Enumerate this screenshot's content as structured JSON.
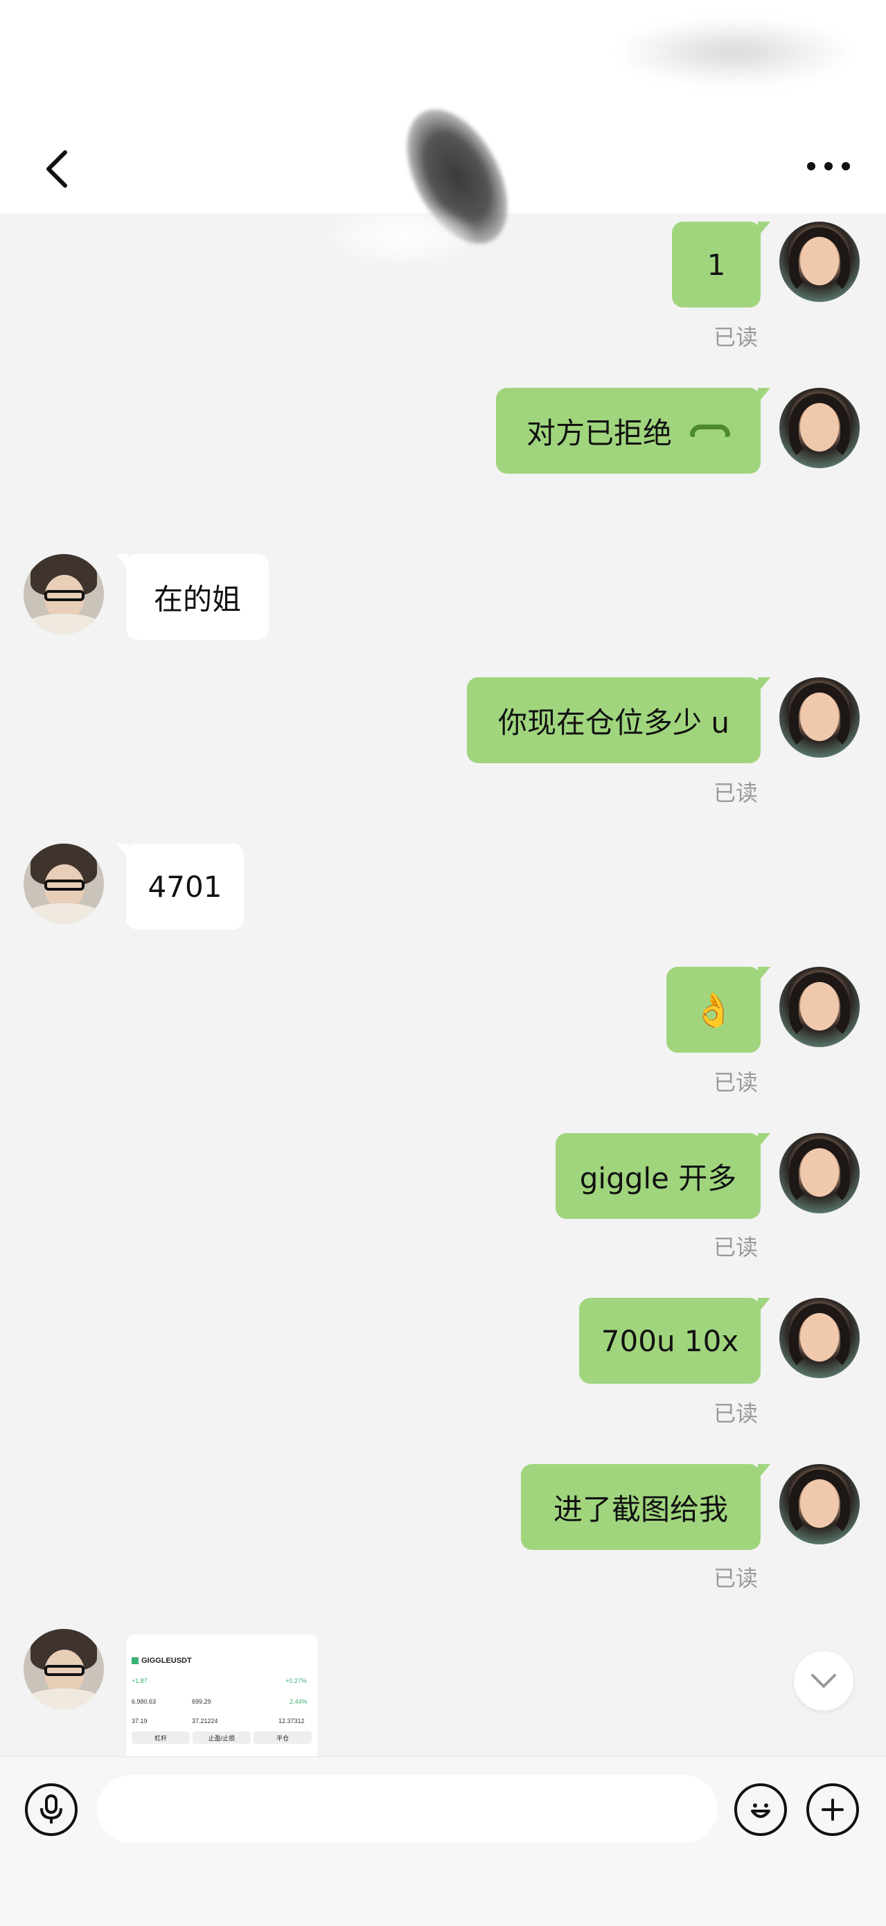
{
  "header": {
    "back_icon": "chevron-left-icon",
    "more_icon": "more-horizontal-icon"
  },
  "messages": [
    {
      "side": "out",
      "text": "1",
      "read": "已读"
    },
    {
      "side": "out",
      "text": "对方已拒绝",
      "icon": "phone-hangup-icon"
    },
    {
      "side": "in",
      "text": "在的姐"
    },
    {
      "side": "out",
      "text": "你现在仓位多少 u",
      "read": "已读"
    },
    {
      "side": "in",
      "text": "4701"
    },
    {
      "side": "out",
      "text": "👌",
      "read": "已读"
    },
    {
      "side": "out",
      "text": "giggle 开多",
      "read": "已读"
    },
    {
      "side": "out",
      "text": "700u 10x",
      "read": "已读"
    },
    {
      "side": "out",
      "text": "进了截图给我",
      "read": "已读"
    },
    {
      "side": "in",
      "type": "image",
      "image": {
        "symbol": "GIGGLEUSDT",
        "rows": [
          {
            "l": "+1.87",
            "r": "+0.27%"
          },
          {
            "l": "6,980.63",
            "m": "699.29",
            "r": "2.44%"
          },
          {
            "l": "37.19",
            "m": "37.21224",
            "r": "12.37312"
          }
        ],
        "buttons": [
          "杠杆",
          "止盈/止损",
          "平仓"
        ]
      }
    }
  ],
  "input": {
    "placeholder": "",
    "voice_icon": "microphone-icon",
    "emoji_icon": "emoji-icon",
    "plus_icon": "plus-icon"
  },
  "scroll_down_icon": "chevron-down-icon"
}
